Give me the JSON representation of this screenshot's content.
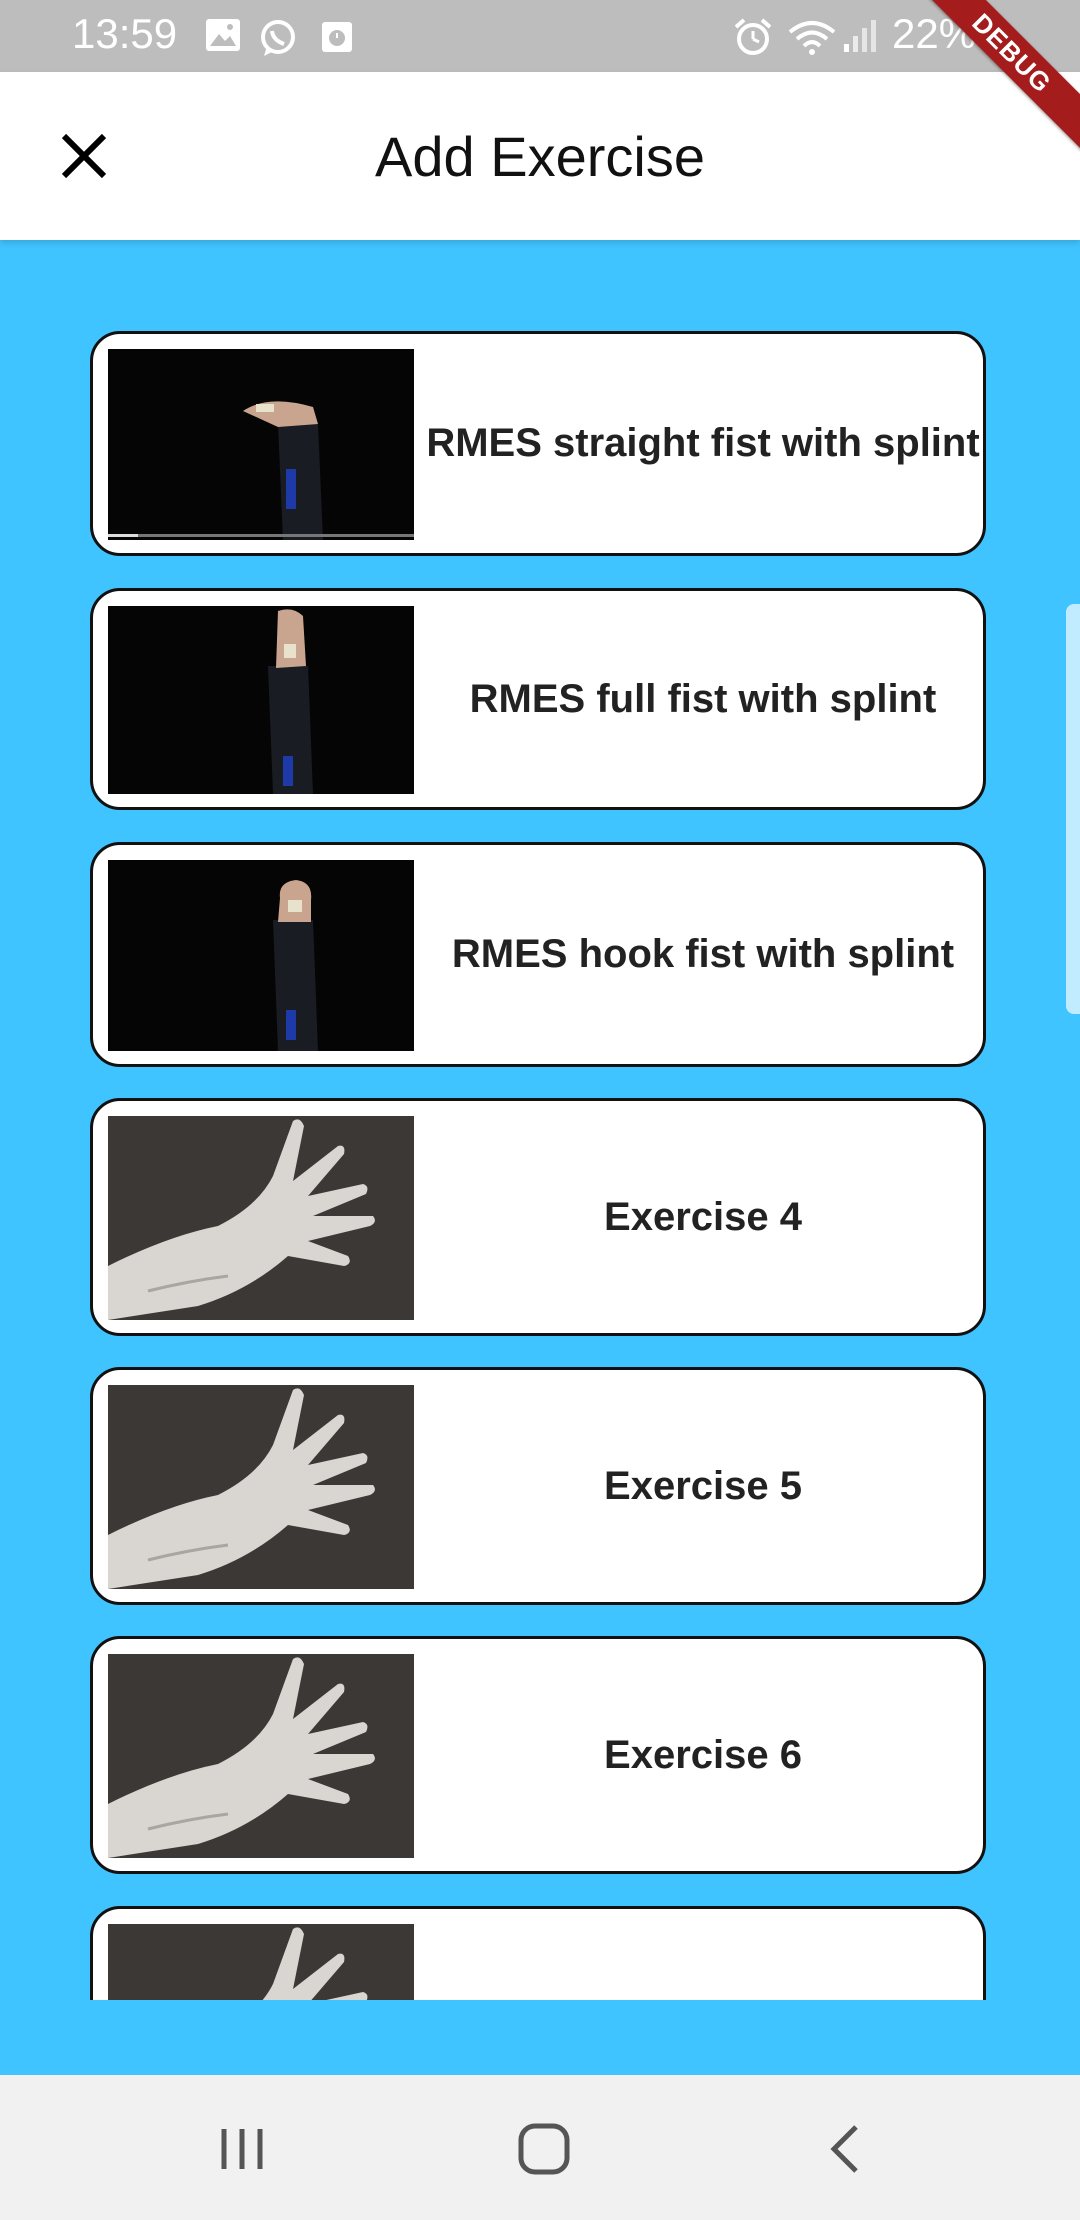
{
  "status_bar": {
    "time": "13:59",
    "battery": "22%",
    "left_icons": [
      "image-icon",
      "whatsapp-icon",
      "calendar-icon"
    ],
    "right_icons": [
      "alarm-icon",
      "wifi-icon",
      "signal-icon"
    ]
  },
  "debug_banner": "DEBUG",
  "app_bar": {
    "title": "Add Exercise",
    "close_icon": "close-icon"
  },
  "colors": {
    "background": "#40c4ff",
    "card": "#ffffff",
    "card_border": "#111111",
    "app_bar": "#ffffff",
    "status_bar": "#bdbdbd",
    "debug_ribbon": "#a41c1c"
  },
  "exercises": [
    {
      "label": "RMES straight fist with splint",
      "thumbnail": "splint-video-thumbnail"
    },
    {
      "label": "RMES full fist with splint",
      "thumbnail": "splint-video-thumbnail"
    },
    {
      "label": "RMES hook fist with splint",
      "thumbnail": "splint-video-thumbnail"
    },
    {
      "label": "Exercise 4",
      "thumbnail": "open-hand-photo"
    },
    {
      "label": "Exercise 5",
      "thumbnail": "open-hand-photo"
    },
    {
      "label": "Exercise 6",
      "thumbnail": "open-hand-photo"
    },
    {
      "label": "",
      "thumbnail": "open-hand-photo"
    }
  ],
  "nav_bar": {
    "buttons": [
      "recent-apps-icon",
      "home-icon",
      "back-icon"
    ]
  }
}
